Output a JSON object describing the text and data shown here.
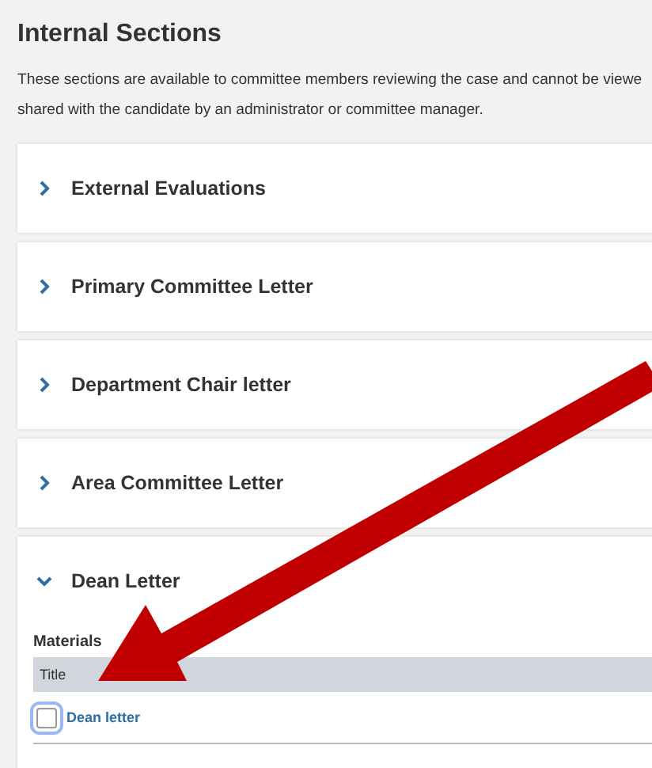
{
  "heading": "Internal Sections",
  "description_lines": [
    "These sections are available to committee members reviewing the case and cannot be viewe",
    "shared with the candidate by an administrator or committee manager."
  ],
  "sections": [
    {
      "title": "External Evaluations",
      "expanded": false
    },
    {
      "title": "Primary Committee Letter",
      "expanded": false
    },
    {
      "title": "Department Chair letter",
      "expanded": false
    },
    {
      "title": "Area Committee Letter",
      "expanded": false
    },
    {
      "title": "Dean Letter",
      "expanded": true,
      "materials": {
        "label": "Materials",
        "columns": [
          "Title"
        ],
        "rows": [
          {
            "title": "Dean letter",
            "checked": false
          }
        ]
      }
    }
  ]
}
